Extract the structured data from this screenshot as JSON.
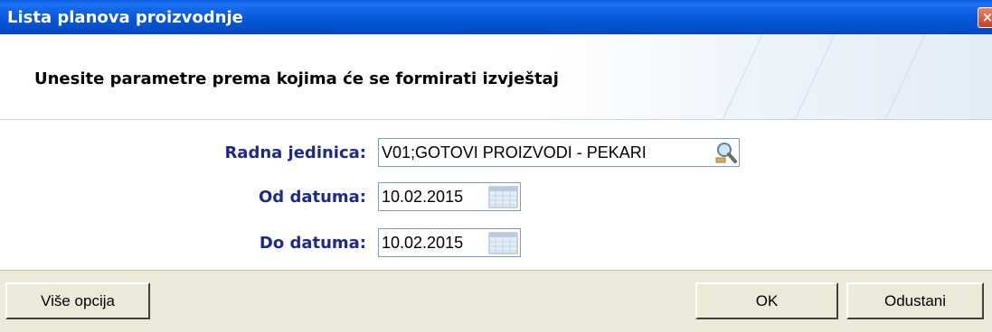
{
  "window": {
    "title": "Lista planova proizvodnje",
    "close_label": "×"
  },
  "header": {
    "instruction": "Unesite parametre prema kojima će se formirati izvještaj"
  },
  "form": {
    "work_unit": {
      "label": "Radna jedinica:",
      "value": "V01;GOTOVI PROIZVODI - PEKARI"
    },
    "date_from": {
      "label": "Od datuma:",
      "value": "10.02.2015"
    },
    "date_to": {
      "label": "Do datuma:",
      "value": "10.02.2015"
    }
  },
  "buttons": {
    "more_options": "Više opcija",
    "ok": "OK",
    "cancel": "Odustani"
  },
  "colors": {
    "titlebar": "#0758d8",
    "label_text": "#1d2a8c",
    "window_bg": "#ece9d8"
  }
}
